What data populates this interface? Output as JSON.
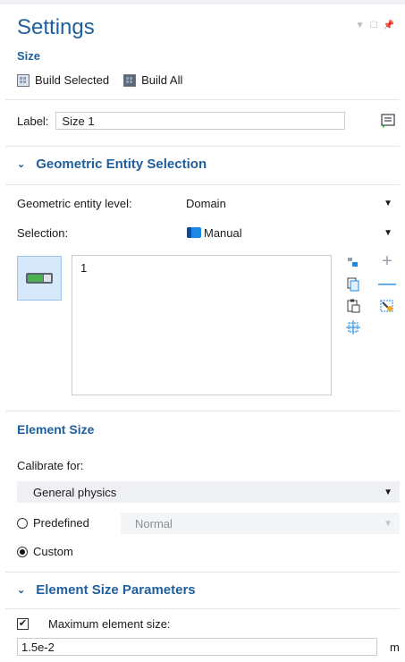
{
  "panel": {
    "title": "Settings",
    "subtitle": "Size"
  },
  "toolbar": {
    "build_selected": "Build Selected",
    "build_all": "Build All"
  },
  "label_field": {
    "label": "Label:",
    "value": "Size 1"
  },
  "geometric": {
    "section_title": "Geometric Entity Selection",
    "level_label": "Geometric entity level:",
    "level_value": "Domain",
    "selection_label": "Selection:",
    "selection_value": "Manual",
    "selected_items": [
      "1"
    ]
  },
  "element_size": {
    "section_title": "Element Size",
    "calibrate_label": "Calibrate for:",
    "calibrate_value": "General physics",
    "predefined_label": "Predefined",
    "predefined_value": "Normal",
    "custom_label": "Custom",
    "selected_option": "Custom"
  },
  "params": {
    "section_title": "Element Size Parameters",
    "max_size_label": "Maximum element size:",
    "max_size_checked": true,
    "max_size_value": "1.5e-2",
    "unit": "m"
  },
  "colors": {
    "accent": "#1f5f9e",
    "toggle_bg": "#d7e8fb",
    "manual_icon": "#1e88e5"
  }
}
